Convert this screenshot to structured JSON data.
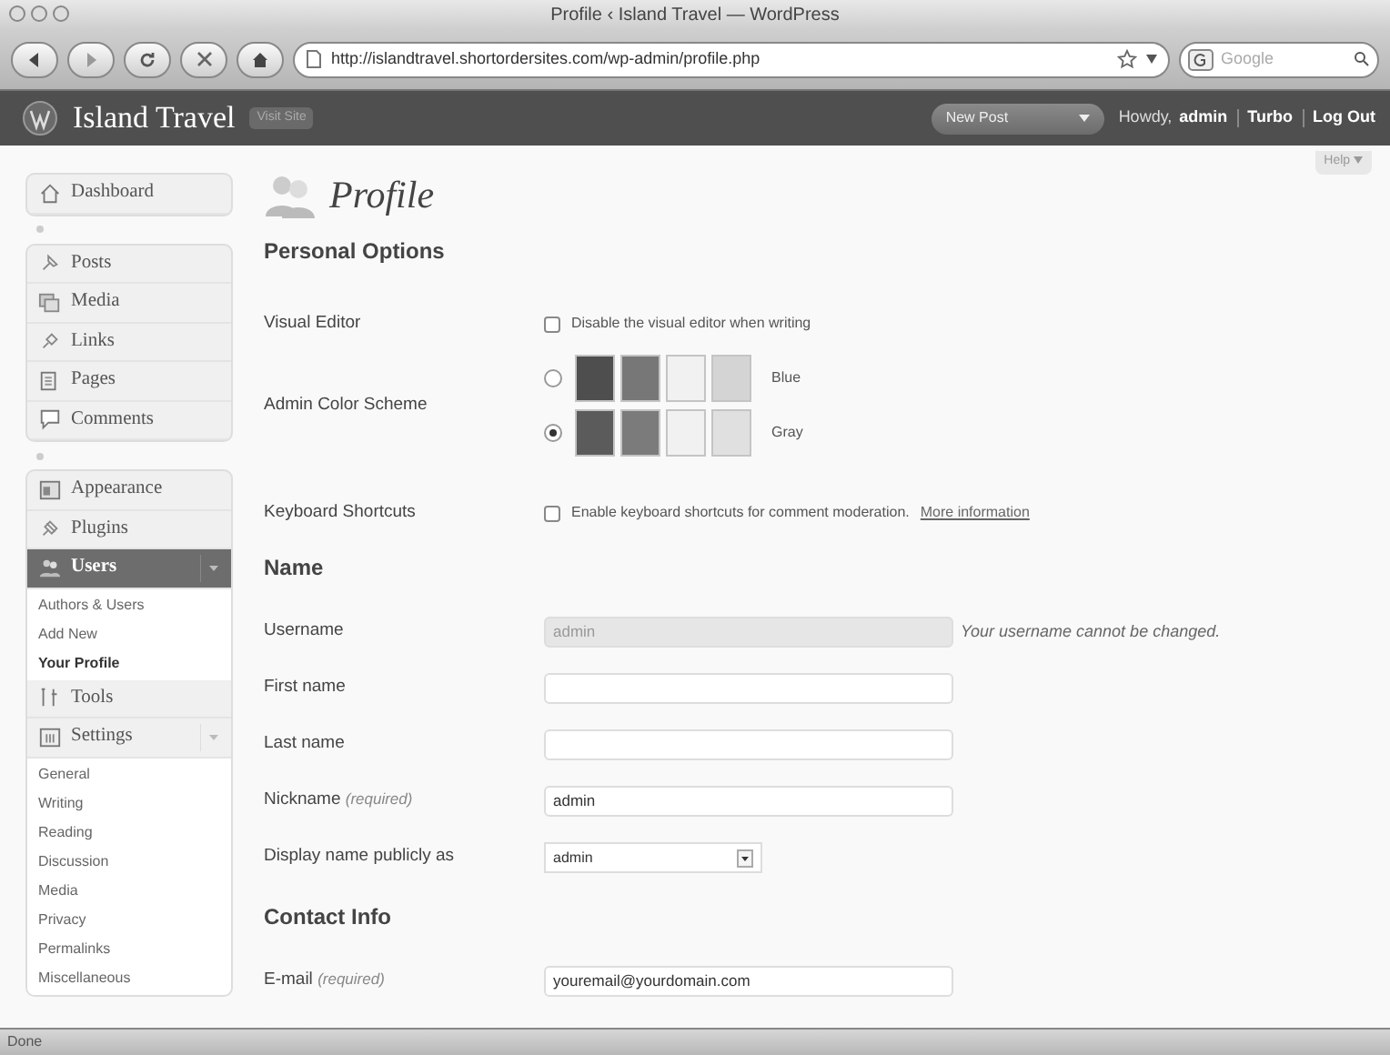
{
  "browser": {
    "title": "Profile ‹ Island Travel — WordPress",
    "url": "http://islandtravel.shortordersites.com/wp-admin/profile.php",
    "search_placeholder": "Google"
  },
  "header": {
    "site_title": "Island Travel",
    "visit_site": "Visit Site",
    "new_post": "New Post",
    "howdy": "Howdy,",
    "user": "admin",
    "links": [
      "Turbo",
      "Log Out"
    ]
  },
  "help": "Help",
  "menu": [
    {
      "kind": "item",
      "label": "Dashboard",
      "selected": false
    },
    {
      "kind": "separator"
    },
    {
      "kind": "item",
      "label": "Posts",
      "selected": false
    },
    {
      "kind": "item",
      "label": "Media",
      "selected": false
    },
    {
      "kind": "item",
      "label": "Links",
      "selected": false
    },
    {
      "kind": "item",
      "label": "Pages",
      "selected": false
    },
    {
      "kind": "item",
      "label": "Comments",
      "selected": false
    },
    {
      "kind": "separator"
    },
    {
      "kind": "item",
      "label": "Appearance",
      "selected": false
    },
    {
      "kind": "item",
      "label": "Plugins",
      "selected": false
    },
    {
      "kind": "item",
      "label": "Users",
      "selected": true,
      "expanded": true,
      "children": [
        {
          "label": "Authors & Users",
          "selected": false
        },
        {
          "label": "Add New",
          "selected": false
        },
        {
          "label": "Your Profile",
          "selected": true
        }
      ]
    },
    {
      "kind": "item",
      "label": "Tools",
      "selected": false
    },
    {
      "kind": "item",
      "label": "Settings",
      "selected": false,
      "expanded": true,
      "children": [
        {
          "label": "General",
          "selected": false
        },
        {
          "label": "Writing",
          "selected": false
        },
        {
          "label": "Reading",
          "selected": false
        },
        {
          "label": "Discussion",
          "selected": false
        },
        {
          "label": "Media",
          "selected": false
        },
        {
          "label": "Privacy",
          "selected": false
        },
        {
          "label": "Permalinks",
          "selected": false
        },
        {
          "label": "Miscellaneous",
          "selected": false
        }
      ]
    }
  ],
  "page_title": "Profile",
  "sections": [
    {
      "title": "Personal Options",
      "rows": [
        {
          "kind": "checkbox",
          "label": "Visual Editor",
          "text": "Disable the visual editor when writing",
          "checked": false
        },
        {
          "kind": "color_scheme",
          "label": "Admin Color Scheme",
          "options": [
            {
              "name": "Blue",
              "selected": false
            },
            {
              "name": "Gray",
              "selected": true
            }
          ]
        },
        {
          "kind": "checkbox",
          "label": "Keyboard Shortcuts",
          "text": "Enable keyboard shortcuts for comment moderation.",
          "link": "More information",
          "checked": false
        }
      ]
    },
    {
      "title": "Name",
      "rows": [
        {
          "kind": "text",
          "label": "Username",
          "value": "admin",
          "disabled": true,
          "note": "Your username cannot be changed."
        },
        {
          "kind": "text",
          "label": "First name",
          "disabled": false
        },
        {
          "kind": "text",
          "label": "Last name",
          "disabled": false
        },
        {
          "kind": "text",
          "label": "Nickname",
          "required": "(required)",
          "value": "admin",
          "disabled": false
        },
        {
          "kind": "select",
          "label": "Display name publicly as",
          "value": "admin"
        }
      ]
    },
    {
      "title": "Contact Info",
      "rows": [
        {
          "kind": "text",
          "label": "E-mail",
          "required": "(required)",
          "value": "youremail@yourdomain.com",
          "disabled": false
        }
      ]
    }
  ],
  "status": "Done"
}
